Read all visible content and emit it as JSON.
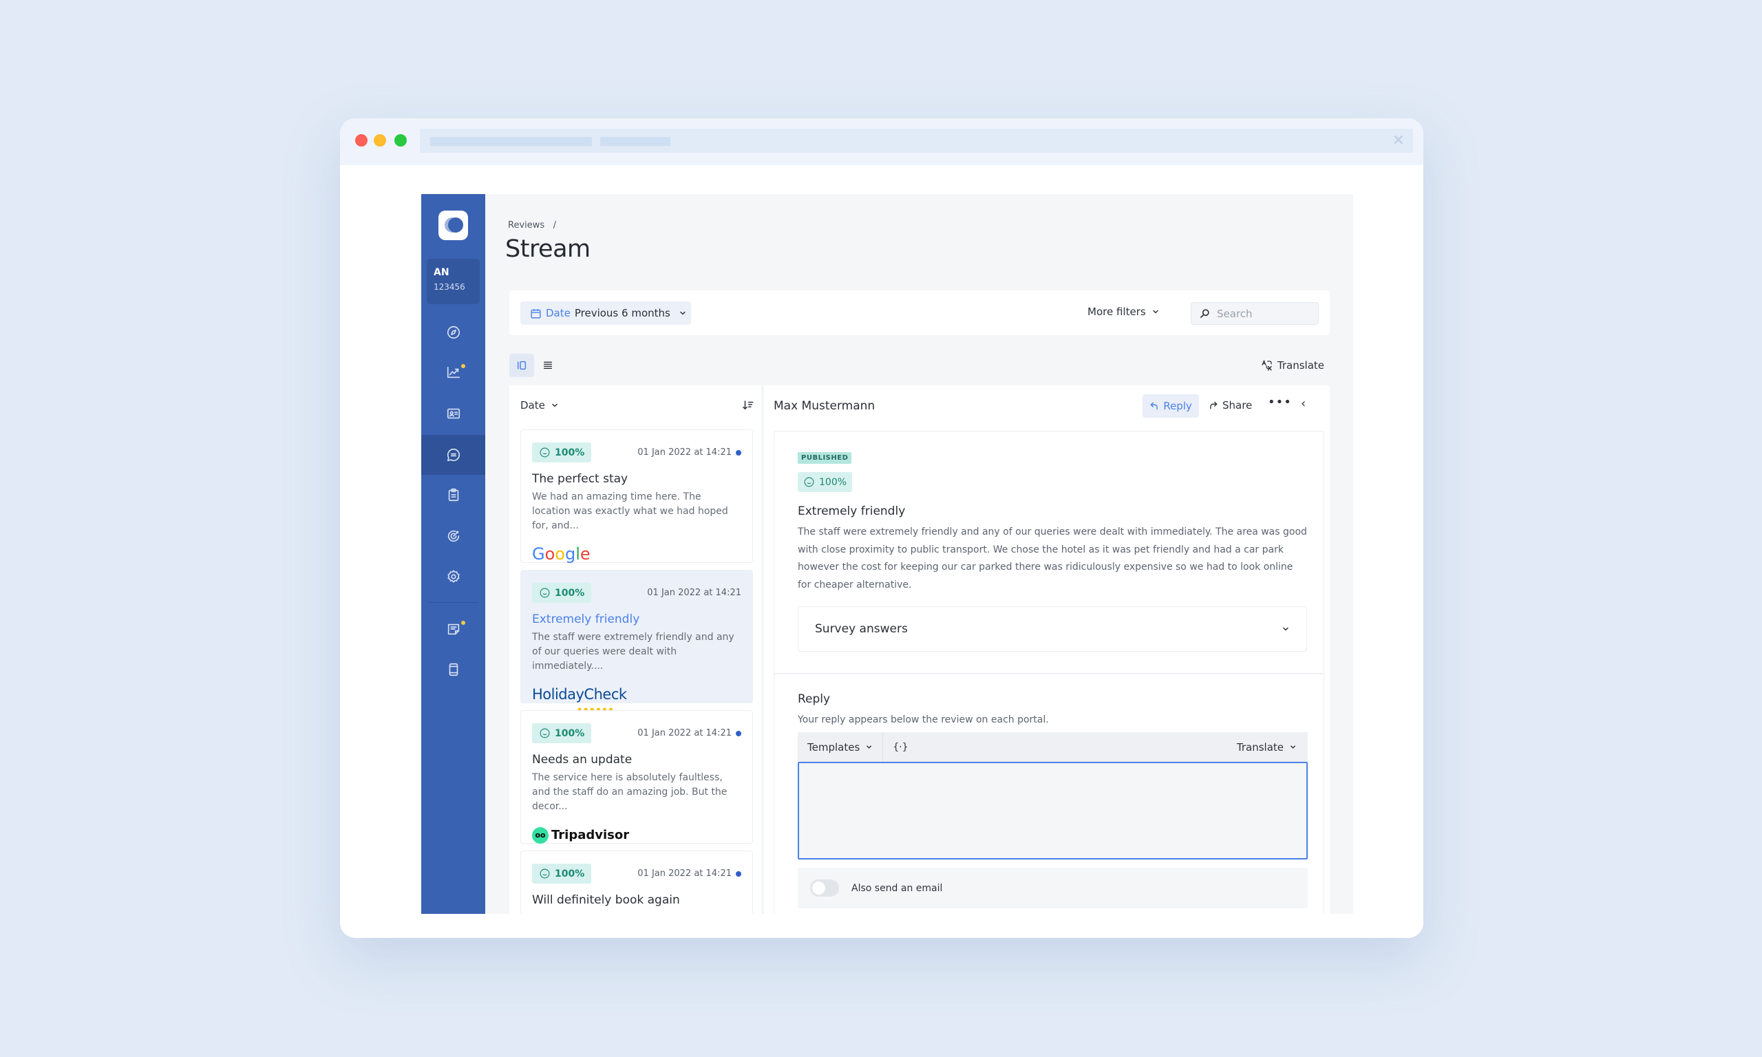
{
  "window": {
    "controls": [
      "close",
      "minimize",
      "maximize"
    ],
    "colors": {
      "close": "#fe5f57",
      "minimize": "#febc2e",
      "maximize": "#28c840"
    }
  },
  "sidebar": {
    "account": {
      "initials": "AN",
      "id": "123456"
    },
    "items": [
      {
        "name": "explore",
        "icon": "compass-icon",
        "active": false,
        "badge": false
      },
      {
        "name": "analytics",
        "icon": "chart-trend-icon",
        "active": false,
        "badge": true
      },
      {
        "name": "listings",
        "icon": "id-card-icon",
        "active": false,
        "badge": false
      },
      {
        "name": "reviews",
        "icon": "chat-bubble-icon",
        "active": true,
        "badge": false
      },
      {
        "name": "surveys",
        "icon": "clipboard-icon",
        "active": false,
        "badge": false
      },
      {
        "name": "goals",
        "icon": "target-icon",
        "active": false,
        "badge": false
      },
      {
        "name": "settings",
        "icon": "gear-icon",
        "active": false,
        "badge": false
      },
      {
        "name": "notes",
        "icon": "note-icon",
        "active": false,
        "badge": true
      },
      {
        "name": "mobile",
        "icon": "tablet-icon",
        "active": false,
        "badge": false
      }
    ]
  },
  "header": {
    "breadcrumb": "Reviews",
    "breadcrumb_sep": "/",
    "title": "Stream"
  },
  "filters": {
    "date_label": "Date",
    "date_value": "Previous 6 months",
    "more_filters": "More filters",
    "search_placeholder": "Search"
  },
  "toolbar": {
    "translate": "Translate"
  },
  "list": {
    "sort_label": "Date",
    "reviews": [
      {
        "score": "100%",
        "date": "01 Jan 2022 at 14:21",
        "unread": true,
        "title": "The perfect stay",
        "excerpt": "We had an amazing time here. The location was exactly what we had hoped for, and...",
        "source": "Google",
        "selected": false
      },
      {
        "score": "100%",
        "date": "01 Jan 2022 at 14:21",
        "unread": false,
        "title": "Extremely friendly",
        "excerpt": "The staff were extremely friendly and any of our queries were dealt with immediately....",
        "source": "HolidayCheck",
        "selected": true
      },
      {
        "score": "100%",
        "date": "01 Jan 2022 at 14:21",
        "unread": true,
        "title": "Needs an update",
        "excerpt": "The service here is absolutely faultless, and the staff do an amazing job. But the decor...",
        "source": "Tripadvisor",
        "selected": false
      },
      {
        "score": "100%",
        "date": "01 Jan 2022 at 14:21",
        "unread": true,
        "title": "Will definitely book again",
        "excerpt": "",
        "source": "",
        "selected": false
      }
    ]
  },
  "detail": {
    "author": "Max Mustermann",
    "reply_btn": "Reply",
    "share_btn": "Share",
    "more_btn": "•••",
    "collapse_btn": "‹",
    "status": "PUBLISHED",
    "score": "100%",
    "title": "Extremely friendly",
    "body": "The staff were extremely friendly and any of our queries were dealt with immediately. The area was good with close proximity to public transport. We chose the hotel as it was pet friendly and had a car park however the cost for keeping our car parked there was ridiculously expensive so we had to look online for cheaper alternative.",
    "survey_label": "Survey answers",
    "reply": {
      "title": "Reply",
      "subtitle": "Your reply appears below the review on each portal.",
      "templates": "Templates",
      "variable": "{·}",
      "translate": "Translate",
      "text": "",
      "email_label": "Also send an email",
      "email_on": false
    }
  },
  "colors": {
    "sidebar": "#3a62b2",
    "accent": "#4a82e8",
    "score_bg": "#d7f1ee",
    "score_fg": "#1d8a74"
  }
}
